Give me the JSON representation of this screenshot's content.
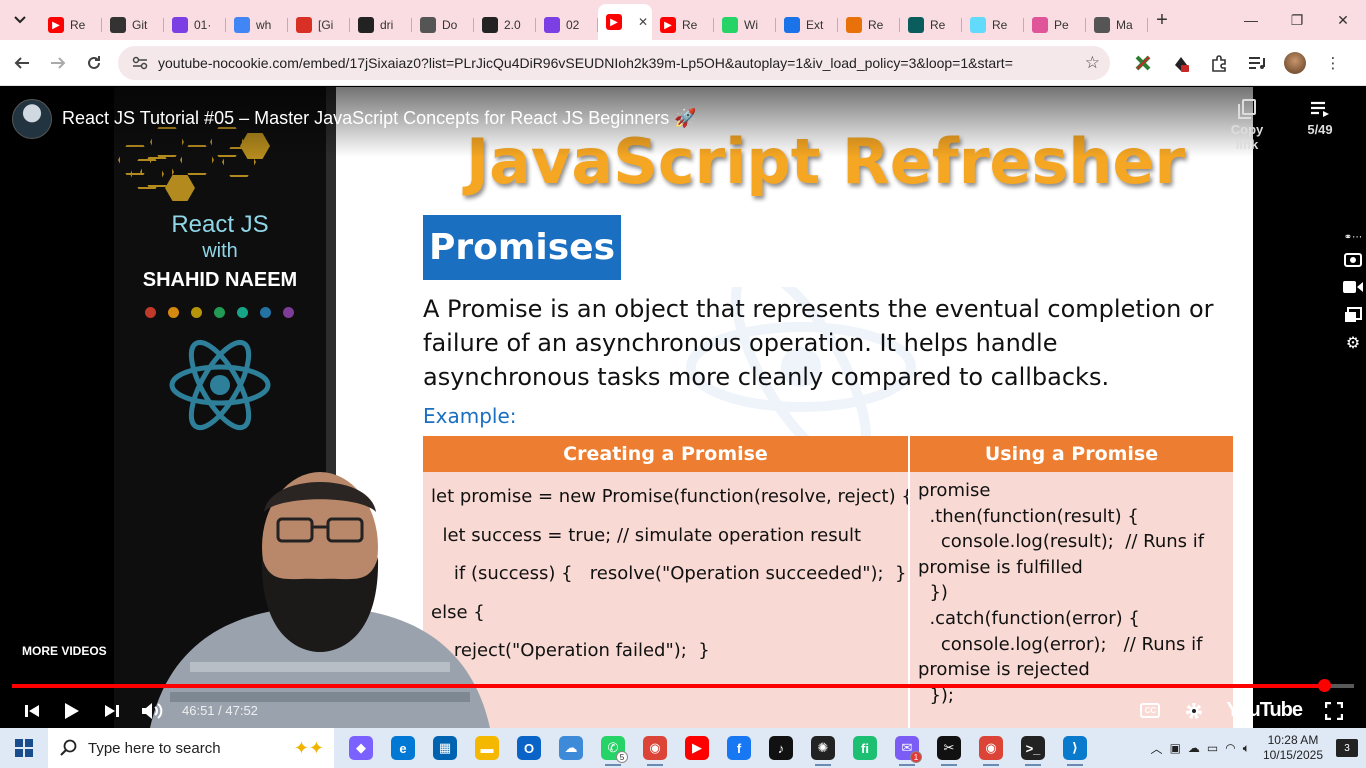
{
  "browser": {
    "tabs": [
      {
        "label": "Re",
        "icon": "youtube-icon",
        "color": "#ff0000"
      },
      {
        "label": "Git",
        "icon": "chatgpt-icon",
        "color": "#333333"
      },
      {
        "label": "01·",
        "icon": "vite-icon",
        "color": "#7b3fe4"
      },
      {
        "label": "wh",
        "icon": "google-icon",
        "color": "#4285f4"
      },
      {
        "label": "[Gi",
        "icon": "gmail-icon",
        "color": "#d93025"
      },
      {
        "label": "dri",
        "icon": "drive-icon",
        "color": "#222222"
      },
      {
        "label": "Do",
        "icon": "globe-icon",
        "color": "#555555"
      },
      {
        "label": "2.0",
        "icon": "threads-icon",
        "color": "#222222"
      },
      {
        "label": "02",
        "icon": "vite-icon",
        "color": "#7b3fe4"
      },
      {
        "label": "",
        "icon": "youtube-icon",
        "color": "#ff0000",
        "active": true
      },
      {
        "label": "Re",
        "icon": "youtube-icon",
        "color": "#ff0000"
      },
      {
        "label": "Wi",
        "icon": "whatsapp-icon",
        "color": "#25d366"
      },
      {
        "label": "Ext",
        "icon": "puzzle-icon",
        "color": "#1a73e8"
      },
      {
        "label": "Re",
        "icon": "rainbow-icon",
        "color": "#e8710a"
      },
      {
        "label": "Re",
        "icon": "react-icon",
        "color": "#0b5d5d"
      },
      {
        "label": "Re",
        "icon": "react-icon",
        "color": "#61dafb"
      },
      {
        "label": "Pe",
        "icon": "pexels-icon",
        "color": "#e0559a"
      },
      {
        "label": "Ma",
        "icon": "globe-icon",
        "color": "#555555"
      }
    ],
    "url": "youtube-nocookie.com/embed/17jSixaiaz0?list=PLrJicQu4DiR96vSEUDNIoh2k39m-Lp5OH&autoplay=1&iv_load_policy=3&loop=1&start="
  },
  "player": {
    "video_title": "React JS Tutorial #05 – Master JavaScript Concepts for React JS Beginners 🚀",
    "copy_link_label": "Copy link",
    "playlist_position": "5/49",
    "more_videos_label": "MORE VIDEOS",
    "time_display": "46:51 / 47:52",
    "progress_fraction": 0.978,
    "brand_logo": "YouTube"
  },
  "slide": {
    "brand_line1": "React JS",
    "brand_line2": "with",
    "brand_name": "SHAHID NAEEM",
    "dot_colors": [
      "#c0392b",
      "#d68910",
      "#b7950b",
      "#229954",
      "#17a589",
      "#2471a3",
      "#7d3c98"
    ],
    "title": "JavaScript Refresher",
    "section": "Promises",
    "description": "A Promise is an object that represents the eventual completion or failure of an asynchronous operation. It helps handle asynchronous tasks more cleanly compared to callbacks.",
    "example_label": "Example:",
    "col1_header": "Creating a Promise",
    "col2_header": "Using a Promise",
    "col1_code": "let promise = new Promise(function(resolve, reject) {\n  let success = true; // simulate operation result\n    if (success) {   resolve(\"Operation succeeded\");  }\nelse {\n    reject(\"Operation failed\");  }",
    "col2_code": "promise\n  .then(function(result) {\n    console.log(result);  // Runs if\npromise is fulfilled\n  })\n  .catch(function(error) {\n    console.log(error);   // Runs if\npromise is rejected\n  });"
  },
  "taskbar": {
    "search_placeholder": "Type here to search",
    "time": "10:28 AM",
    "date": "10/15/2025",
    "notification_count": "3",
    "whatsapp_badge": "5",
    "messenger_badge": "1",
    "apps": [
      "copilot-icon",
      "edge-icon",
      "store-icon",
      "file-explorer-icon",
      "outlook-icon",
      "onedrive-icon",
      "whatsapp-icon",
      "chrome-icon",
      "youtube-icon",
      "facebook-icon",
      "tiktok-icon",
      "chatgpt-icon",
      "fiverr-icon",
      "messenger-icon",
      "capcut-icon",
      "chrome-profile-icon",
      "terminal-icon",
      "vscode-icon"
    ]
  }
}
